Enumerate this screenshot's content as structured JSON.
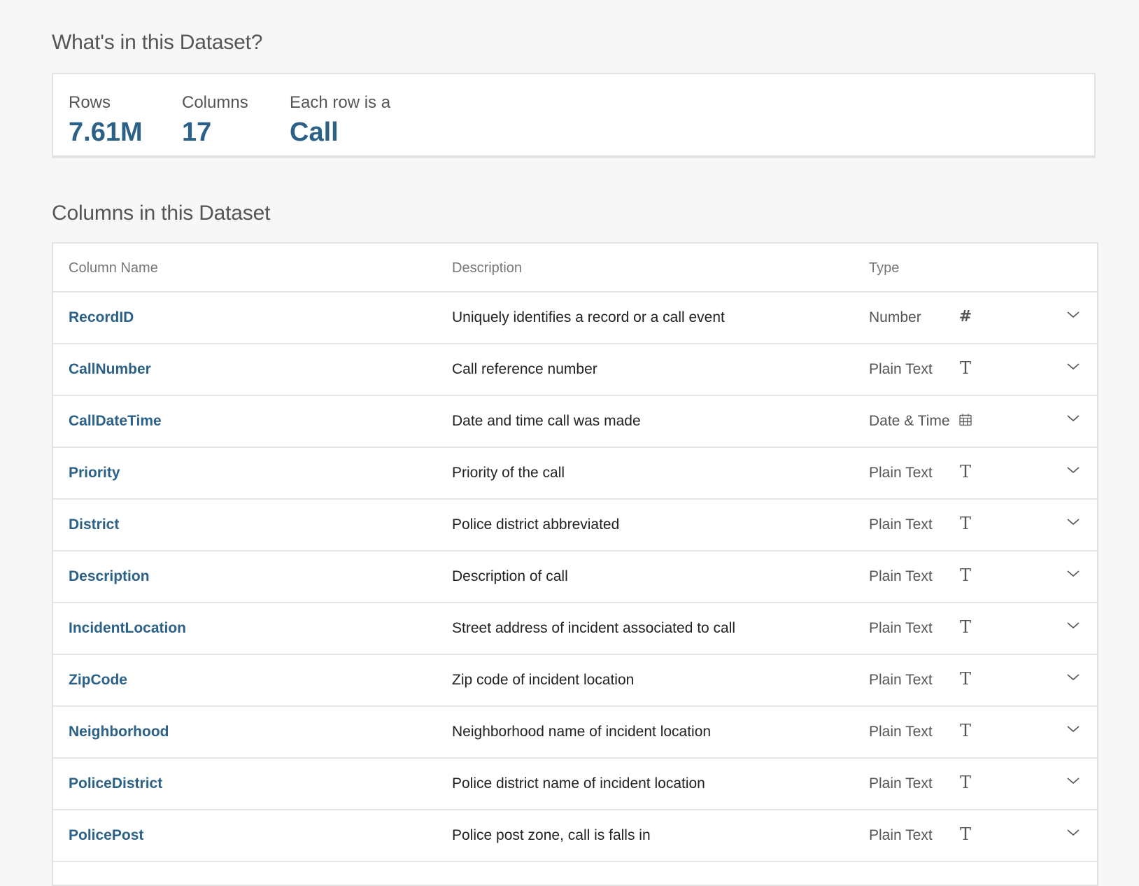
{
  "overview": {
    "title": "What's in this Dataset?",
    "stats": [
      {
        "label": "Rows",
        "value": "7.61M"
      },
      {
        "label": "Columns",
        "value": "17"
      },
      {
        "label": "Each row is a",
        "value": "Call"
      }
    ]
  },
  "columns_section": {
    "title": "Columns in this Dataset",
    "headers": {
      "name": "Column Name",
      "description": "Description",
      "type": "Type"
    },
    "rows": [
      {
        "name": "RecordID",
        "description": "Uniquely identifies a record or a call event",
        "type": "Number",
        "icon": "number-icon"
      },
      {
        "name": "CallNumber",
        "description": "Call reference number",
        "type": "Plain Text",
        "icon": "text-icon"
      },
      {
        "name": "CallDateTime",
        "description": "Date and time call was made",
        "type": "Date & Time",
        "icon": "calendar-icon"
      },
      {
        "name": "Priority",
        "description": "Priority of the call",
        "type": "Plain Text",
        "icon": "text-icon"
      },
      {
        "name": "District",
        "description": "Police district abbreviated",
        "type": "Plain Text",
        "icon": "text-icon"
      },
      {
        "name": "Description",
        "description": "Description of call",
        "type": "Plain Text",
        "icon": "text-icon"
      },
      {
        "name": "IncidentLocation",
        "description": "Street address of incident associated to call",
        "type": "Plain Text",
        "icon": "text-icon"
      },
      {
        "name": "ZipCode",
        "description": "Zip code of incident location",
        "type": "Plain Text",
        "icon": "text-icon"
      },
      {
        "name": "Neighborhood",
        "description": "Neighborhood name of incident location",
        "type": "Plain Text",
        "icon": "text-icon"
      },
      {
        "name": "PoliceDistrict",
        "description": "Police district name of incident location",
        "type": "Plain Text",
        "icon": "text-icon"
      },
      {
        "name": "PolicePost",
        "description": "Police post zone, call is falls in",
        "type": "Plain Text",
        "icon": "text-icon"
      }
    ]
  },
  "colors": {
    "link": "#2c6187",
    "background": "#f7f7f7",
    "border": "#e3e3e3"
  }
}
